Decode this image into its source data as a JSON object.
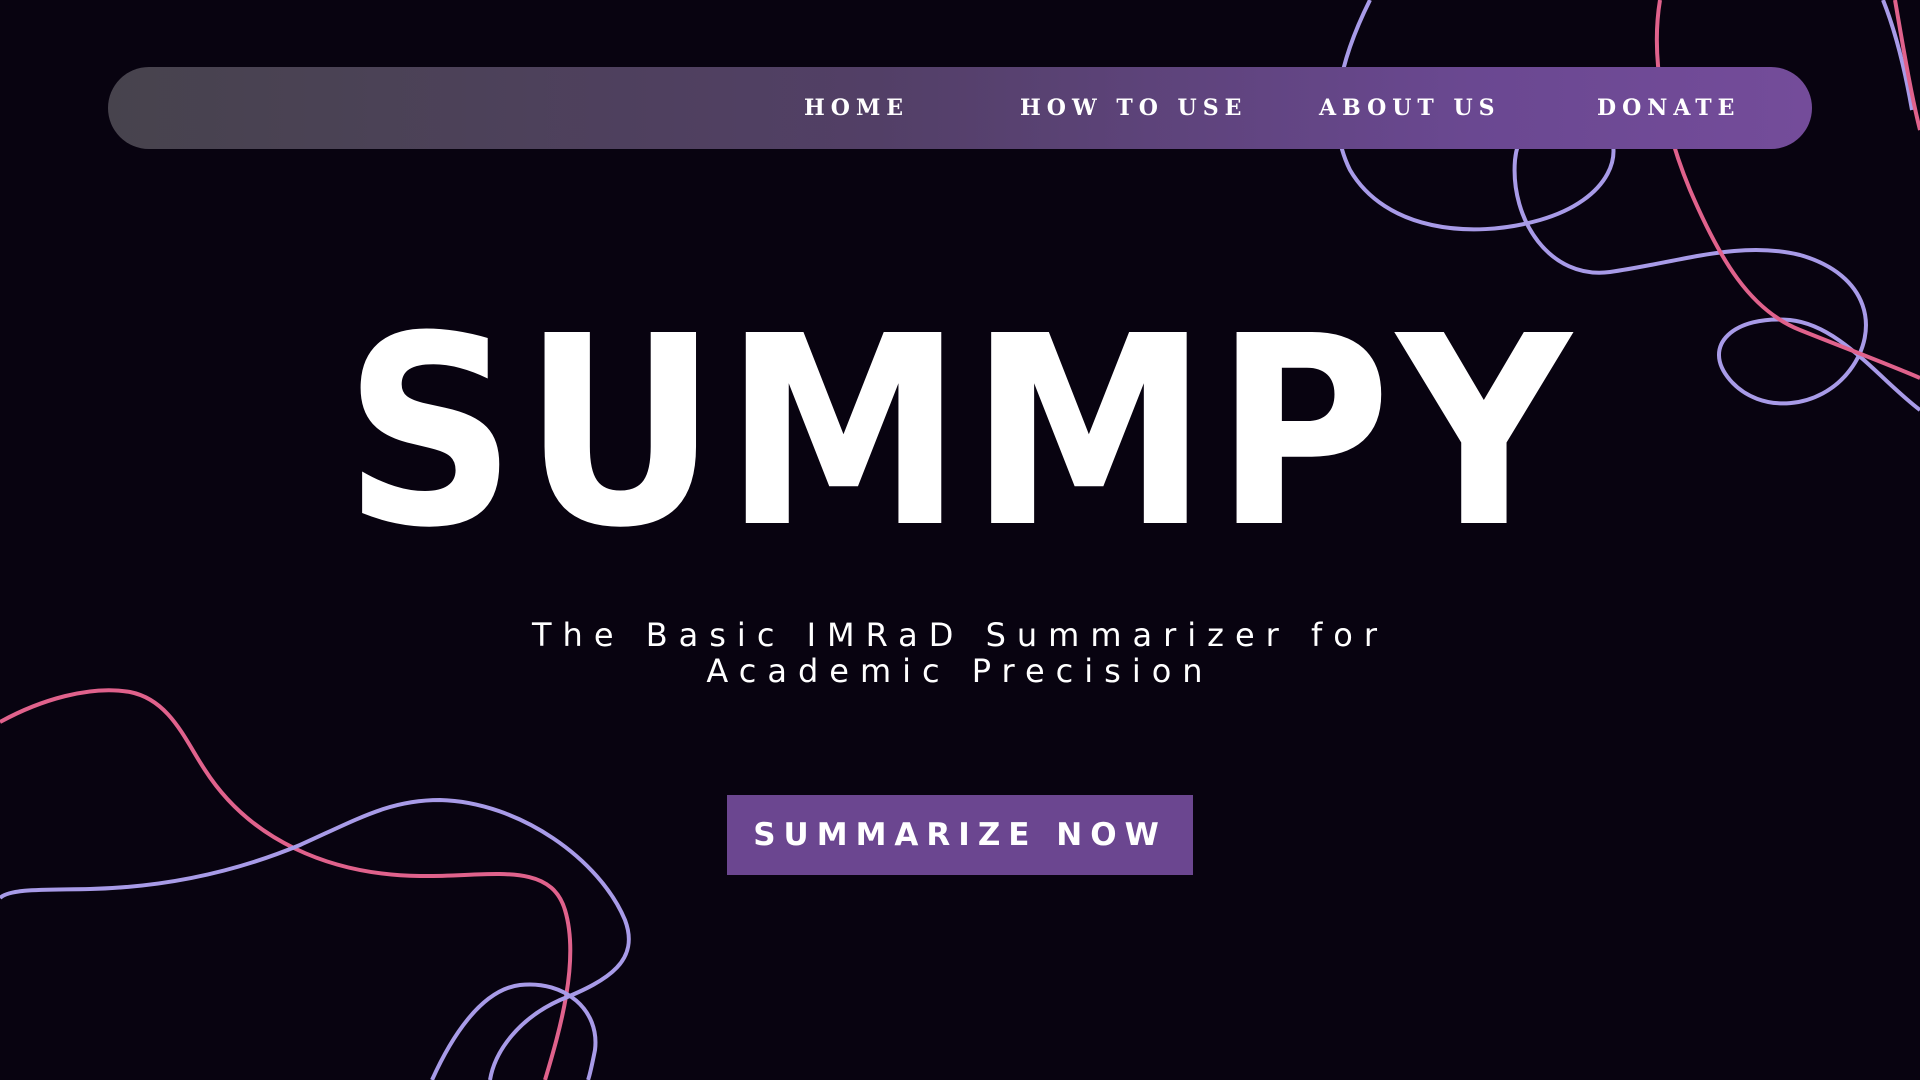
{
  "navbar": {
    "links": [
      {
        "label": "HOME"
      },
      {
        "label": "HOW TO USE"
      },
      {
        "label": "ABOUT US"
      },
      {
        "label": "DONATE"
      }
    ]
  },
  "hero": {
    "title": "SUMMPY",
    "subtitle": "The Basic IMRaD Summarizer for Academic Precision",
    "cta_label": "SUMMARIZE NOW"
  },
  "colors": {
    "background": "#080310",
    "accent_purple": "#6b4690",
    "line_lavender": "#a89be8",
    "line_pink": "#e0628c"
  }
}
